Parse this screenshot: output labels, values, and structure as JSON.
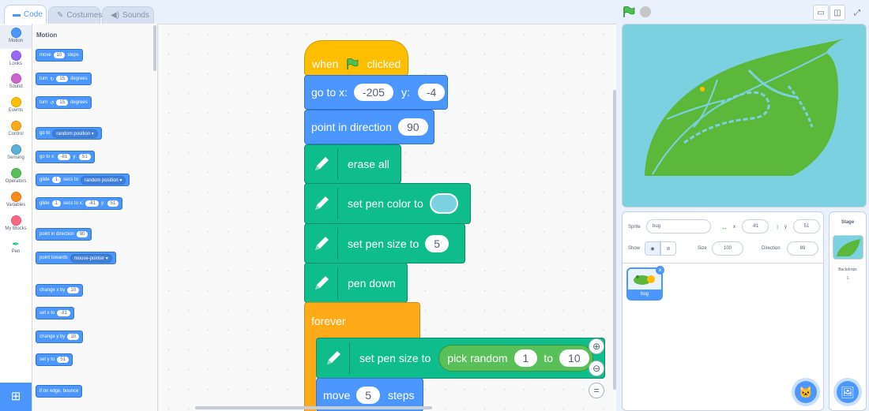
{
  "tabs": [
    {
      "label": "Code",
      "icon": "code-icon"
    },
    {
      "label": "Costumes",
      "icon": "brush-icon"
    },
    {
      "label": "Sounds",
      "icon": "speaker-icon"
    }
  ],
  "categories": [
    {
      "label": "Motion",
      "color": "#4c97ff"
    },
    {
      "label": "Looks",
      "color": "#9966ff"
    },
    {
      "label": "Sound",
      "color": "#cf63cf"
    },
    {
      "label": "Events",
      "color": "#ffbf00"
    },
    {
      "label": "Control",
      "color": "#ffab19"
    },
    {
      "label": "Sensing",
      "color": "#5cb1d6"
    },
    {
      "label": "Operators",
      "color": "#59c059"
    },
    {
      "label": "Variables",
      "color": "#ff8c1a"
    },
    {
      "label": "My Blocks",
      "color": "#ff6680"
    },
    {
      "label": "Pen",
      "color": "#0fbd8c"
    }
  ],
  "palette": {
    "title": "Motion",
    "move": {
      "a": "move",
      "n": "10",
      "b": "steps"
    },
    "turn_right": {
      "a": "turn",
      "n": "15",
      "b": "degrees"
    },
    "turn_left": {
      "a": "turn",
      "n": "15",
      "b": "degrees"
    },
    "goto": {
      "a": "go to",
      "opt": "random position"
    },
    "goto_xy": {
      "a": "go to x:",
      "x": "-81",
      "yl": "y:",
      "y": "51"
    },
    "glide": {
      "a": "glide",
      "n": "1",
      "b": "secs to",
      "opt": "random position"
    },
    "glide_xy": {
      "a": "glide",
      "n": "1",
      "b": "secs to x:",
      "x": "-81",
      "yl": "y:",
      "y": "51"
    },
    "point_dir": {
      "a": "point in direction",
      "n": "90"
    },
    "point_towards": {
      "a": "point towards",
      "opt": "mouse-pointer"
    },
    "change_x": {
      "a": "change x by",
      "n": "10"
    },
    "set_x": {
      "a": "set x to",
      "n": "-81"
    },
    "change_y": {
      "a": "change y by",
      "n": "10"
    },
    "set_y": {
      "a": "set y to",
      "n": "51"
    },
    "bounce": {
      "a": "if on edge, bounce"
    }
  },
  "script": {
    "when_flag": {
      "a": "when",
      "b": "clicked"
    },
    "goto_xy": {
      "a": "go to x:",
      "x": "-205",
      "yl": "y:",
      "y": "-4"
    },
    "point_dir": {
      "a": "point in direction",
      "n": "90"
    },
    "erase_all": "erase all",
    "set_color": {
      "a": "set pen color to",
      "color": "#7bd1e0"
    },
    "set_size": {
      "a": "set pen size to",
      "n": "5"
    },
    "pen_down": "pen down",
    "forever": "forever",
    "set_size_rand": {
      "a": "set pen size to",
      "op": "pick random",
      "from": "1",
      "to_label": "to",
      "to": "10"
    },
    "move": {
      "a": "move",
      "n": "5",
      "b": "steps"
    }
  },
  "sprite_info": {
    "sprite_label": "Sprite",
    "sprite_name": "bug",
    "x_label": "x",
    "x": "-81",
    "y_label": "y",
    "y": "51",
    "show_label": "Show",
    "size_label": "Size",
    "size": "100",
    "direction_label": "Direction",
    "direction": "89"
  },
  "sprites": [
    {
      "name": "bug"
    }
  ],
  "stage_pane": {
    "title": "Stage",
    "backdrops_label": "Backdrops",
    "backdrops_count": "1"
  },
  "colors": {
    "stage_bg": "#7bd1e0",
    "leaf": "#5cb83a"
  }
}
